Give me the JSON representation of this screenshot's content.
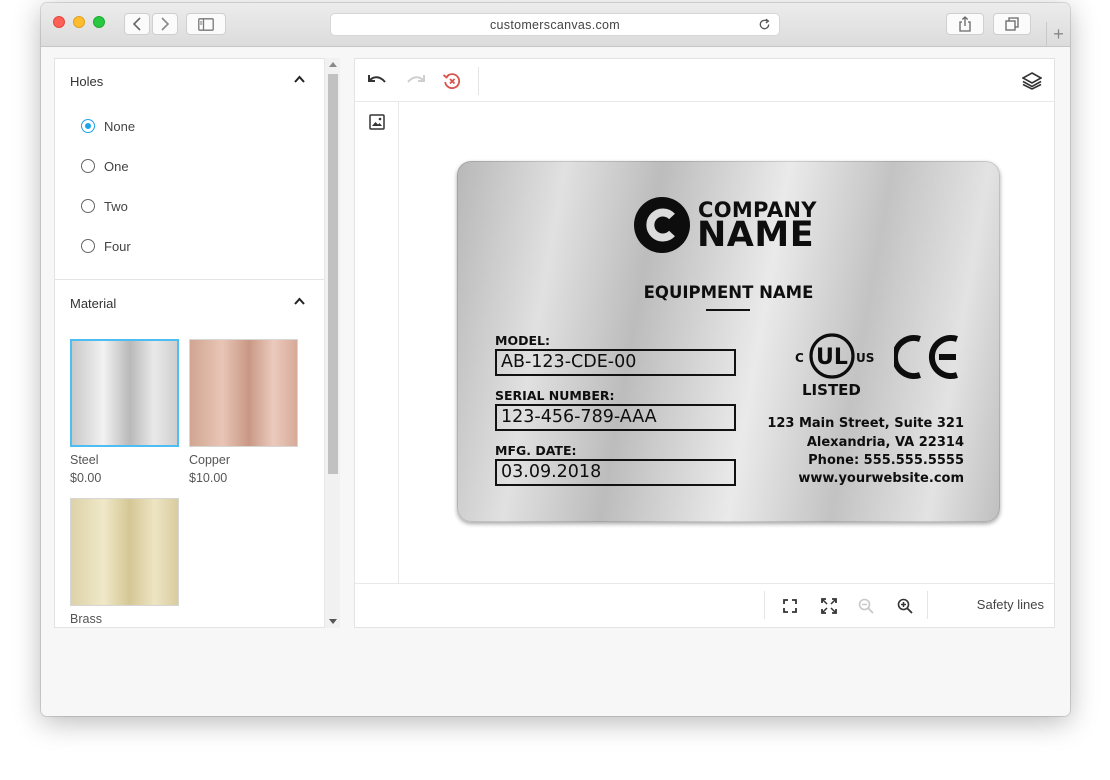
{
  "browser": {
    "url": "customerscanvas.com"
  },
  "sidebar": {
    "holes": {
      "title": "Holes",
      "options": [
        "None",
        "One",
        "Two",
        "Four"
      ],
      "selected": "None"
    },
    "material": {
      "title": "Material",
      "items": [
        {
          "name": "Steel",
          "price": "$0.00",
          "selected": true
        },
        {
          "name": "Copper",
          "price": "$10.00",
          "selected": false
        },
        {
          "name": "Brass",
          "price": "",
          "selected": false
        }
      ]
    }
  },
  "editor": {
    "bottom": {
      "safety_lines_label": "Safety lines"
    }
  },
  "plate": {
    "company_line1": "COMPANY",
    "company_line2": "NAME",
    "equipment_name": "EQUIPMENT NAME",
    "fields": [
      {
        "label": "MODEL:",
        "value": "AB-123-CDE-00"
      },
      {
        "label": "SERIAL NUMBER:",
        "value": "123-456-789-AAA"
      },
      {
        "label": "MFG. DATE:",
        "value": "03.09.2018"
      }
    ],
    "cert": {
      "ul_left": "C",
      "ul_center": "UL",
      "ul_right": "US",
      "listed": "LISTED",
      "ce": "CE"
    },
    "address": [
      "123 Main Street, Suite 321",
      "Alexandria, VA 22314",
      "Phone: 555.555.5555",
      "www.yourwebsite.com"
    ]
  },
  "colors": {
    "accent": "#1ea4e6",
    "selected_border": "#4dbdf2",
    "redo_disabled": "#cfcfcf",
    "reset_icon": "#d9534f"
  }
}
